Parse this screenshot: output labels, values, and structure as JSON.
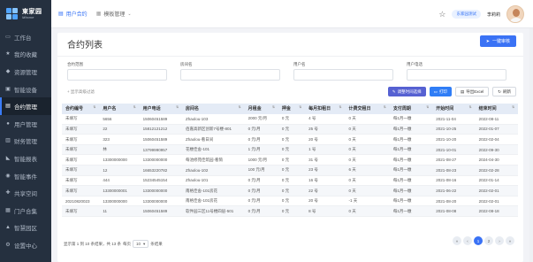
{
  "app": {
    "logo_zh": "東家园",
    "logo_en": "Mhome"
  },
  "sidebar": {
    "items": [
      {
        "label": "工作台",
        "icon": "desktop-icon",
        "glyph": "▭"
      },
      {
        "label": "我的收藏",
        "icon": "star-icon",
        "glyph": "★"
      },
      {
        "label": "资源管理",
        "icon": "resource-icon",
        "glyph": "◆"
      },
      {
        "label": "智能设备",
        "icon": "device-icon",
        "glyph": "▣"
      },
      {
        "label": "合约管理",
        "icon": "contract-icon",
        "glyph": "▤",
        "active": true
      },
      {
        "label": "用户管理",
        "icon": "user-icon",
        "glyph": "●"
      },
      {
        "label": "财务管理",
        "icon": "finance-icon",
        "glyph": "▥"
      },
      {
        "label": "智能报表",
        "icon": "chart-icon",
        "glyph": "◣"
      },
      {
        "label": "智能事件",
        "icon": "event-icon",
        "glyph": "◉"
      },
      {
        "label": "共享空间",
        "icon": "share-icon",
        "glyph": "✚"
      },
      {
        "label": "门户合集",
        "icon": "portal-icon",
        "glyph": "▦"
      },
      {
        "label": "智慧园区",
        "icon": "park-icon",
        "glyph": "▲"
      },
      {
        "label": "设置中心",
        "icon": "settings-icon",
        "glyph": "⚙"
      }
    ]
  },
  "topbar": {
    "tab1": "用户合约",
    "tab2": "模板管理",
    "pill": "东家园测试",
    "username": "李莉莉"
  },
  "page": {
    "title": "合约列表",
    "new_button": "一键审核"
  },
  "filters": {
    "f1": "合约范围",
    "f2": "房间名",
    "f3": "用户名",
    "f4": "用户电话",
    "more": "+ 显示高级过滤"
  },
  "actions": {
    "btn1": "调整时间选择",
    "btn2": "打印",
    "btn3": "导出Excel",
    "btn4": "刷新"
  },
  "table": {
    "headers": [
      "合约编号",
      "用户名",
      "用户电话",
      "房间名",
      "月租金",
      "押金",
      "每月扣租日",
      "计费交租日",
      "支付周期",
      "开始时间",
      "结束时间"
    ],
    "rows": [
      [
        "未填写",
        "5656",
        "15060451589",
        "Zhaolou-103",
        "2000 元/月",
        "0 元",
        "4 号",
        "0 天",
        "每1月一缴",
        "2021-11-04",
        "2022-08-11"
      ],
      [
        "未填写",
        "22",
        "15812121212",
        "佰嘉高新区创新7号楼-801",
        "0 元/月",
        "0 元",
        "25 号",
        "0 天",
        "每1月一缴",
        "2021-10-25",
        "2022-01-07"
      ],
      [
        "未填写",
        "323",
        "15060451589",
        "Zhaolou-看日间",
        "0 元/月",
        "0 元",
        "20 号",
        "0 天",
        "每1月一缴",
        "2021-10-20",
        "2022-02-04"
      ],
      [
        "未填写",
        "林",
        "13799990957",
        "花楼佳舍-101",
        "1 元/月",
        "0 元",
        "1 号",
        "0 天",
        "每1月一缴",
        "2021-10-01",
        "2022-09-30"
      ],
      [
        "未填写",
        "13300000000",
        "13300000000",
        "每池修苑佳筑园-看筒",
        "1000 元/月",
        "0 元",
        "31 号",
        "0 天",
        "每1月一缴",
        "2021-08-27",
        "2024-04-30"
      ],
      [
        "未填写",
        "12",
        "16653220782",
        "Zhaolou-102",
        "100 元/月",
        "0 元",
        "23 号",
        "6 天",
        "每1月一缴",
        "2021-08-23",
        "2022-02-28"
      ],
      [
        "未填写",
        "444",
        "15234545154",
        "Zhaolou-101",
        "0 元/月",
        "0 元",
        "16 号",
        "0 天",
        "每1月一缴",
        "2021-08-16",
        "2022-01-14"
      ],
      [
        "未填写",
        "13300000001",
        "13300000000",
        "南格佳舍-101房花",
        "0 元/月",
        "0 元",
        "22 号",
        "0 天",
        "每1月一缴",
        "2021-06-22",
        "2022-02-01"
      ],
      [
        "20210820023",
        "13300000000",
        "13300000000",
        "南格佳舍-101房花",
        "0 元/月",
        "0 元",
        "20 号",
        "-1 天",
        "每1月一缴",
        "2021-08-20",
        "2022-02-01"
      ],
      [
        "未填写",
        "11",
        "15060451589",
        "软件园三区11号楼四层-501",
        "0 元/月",
        "0 元",
        "8 号",
        "0 天",
        "每1月一缴",
        "2021-08-08",
        "2022-08-18"
      ]
    ]
  },
  "pagination": {
    "prefix": "显示第 1 到 10 条结果，共 13 条",
    "per_page_label": "每页",
    "per_page": "10",
    "suffix": "条结果",
    "pages": [
      "«",
      "‹",
      "1",
      "2",
      "›",
      "»"
    ],
    "current": "1"
  }
}
